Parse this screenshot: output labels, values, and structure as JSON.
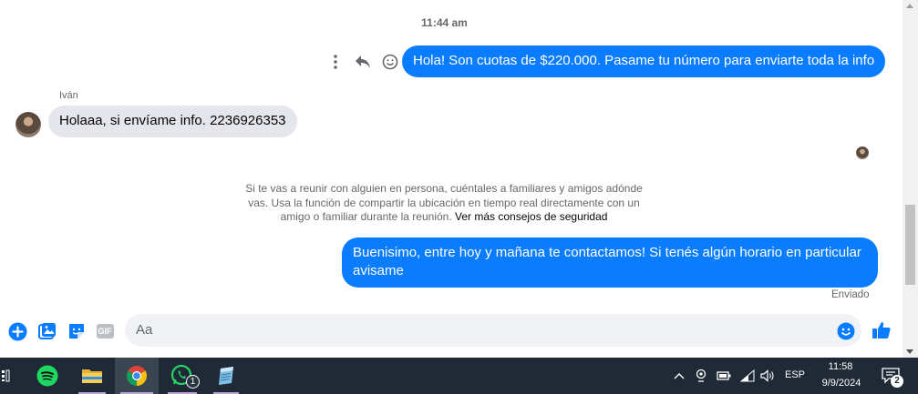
{
  "conversation": {
    "time_divider": "11:44 am",
    "messages": [
      {
        "direction": "out",
        "text": "Hola! Son cuotas de $220.000. Pasame tu número para enviarte toda la info"
      },
      {
        "direction": "in",
        "sender": "Iván",
        "text": "Holaaa, si envíame info. 2236926353"
      },
      {
        "direction": "out",
        "text": "Buenisimo, entre hoy y mañana te contactamos! Si tenés algún horario en particular avisame",
        "status": "Enviado"
      }
    ],
    "safety_notice": {
      "text": "Si te vas a reunir con alguien en persona, cuéntales a familiares y amigos adónde vas. Usa la función de compartir la ubicación en tiempo real directamente con un amigo o familiar durante la reunión. ",
      "link": "Ver más consejos de seguridad"
    }
  },
  "composer": {
    "placeholder": "Aa",
    "gif_label": "GIF"
  },
  "taskbar": {
    "language": "ESP",
    "time": "11:58",
    "date": "9/9/2024",
    "whatsapp_badge": "1",
    "notification_count": "2"
  },
  "colors": {
    "accent": "#0a7cff",
    "incoming_bubble": "#e4e6eb",
    "taskbar": "#1f2a36"
  }
}
